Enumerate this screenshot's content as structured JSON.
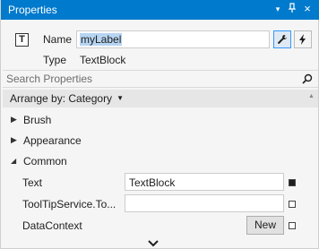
{
  "window": {
    "title": "Properties",
    "title_bar_color": "#007acc",
    "controls": {
      "dropdown": "▾",
      "pin": "⊥",
      "close": "×"
    }
  },
  "element": {
    "type_icon": "T",
    "name_label": "Name",
    "name_value": "myLabel",
    "type_label": "Type",
    "type_value": "TextBlock"
  },
  "buttons": {
    "properties_icon": "wrench-icon",
    "events_icon": "lightning-icon"
  },
  "search": {
    "placeholder": "Search Properties",
    "icon": "search-icon"
  },
  "arrange": {
    "label": "Arrange by: Category",
    "caret": "▼"
  },
  "categories": {
    "brush": {
      "label": "Brush",
      "state": "collapsed",
      "glyph": "▶"
    },
    "appearance": {
      "label": "Appearance",
      "state": "collapsed",
      "glyph": "▶"
    },
    "common": {
      "label": "Common",
      "state": "expanded",
      "glyph": "◢"
    }
  },
  "properties": {
    "text": {
      "label": "Text",
      "value": "TextBlock"
    },
    "tooltip": {
      "label": "ToolTipService.To...",
      "value": ""
    },
    "datacontext": {
      "label": "DataContext",
      "button": "New"
    }
  },
  "footer": {
    "expand_icon": "chevron-down-icon"
  }
}
